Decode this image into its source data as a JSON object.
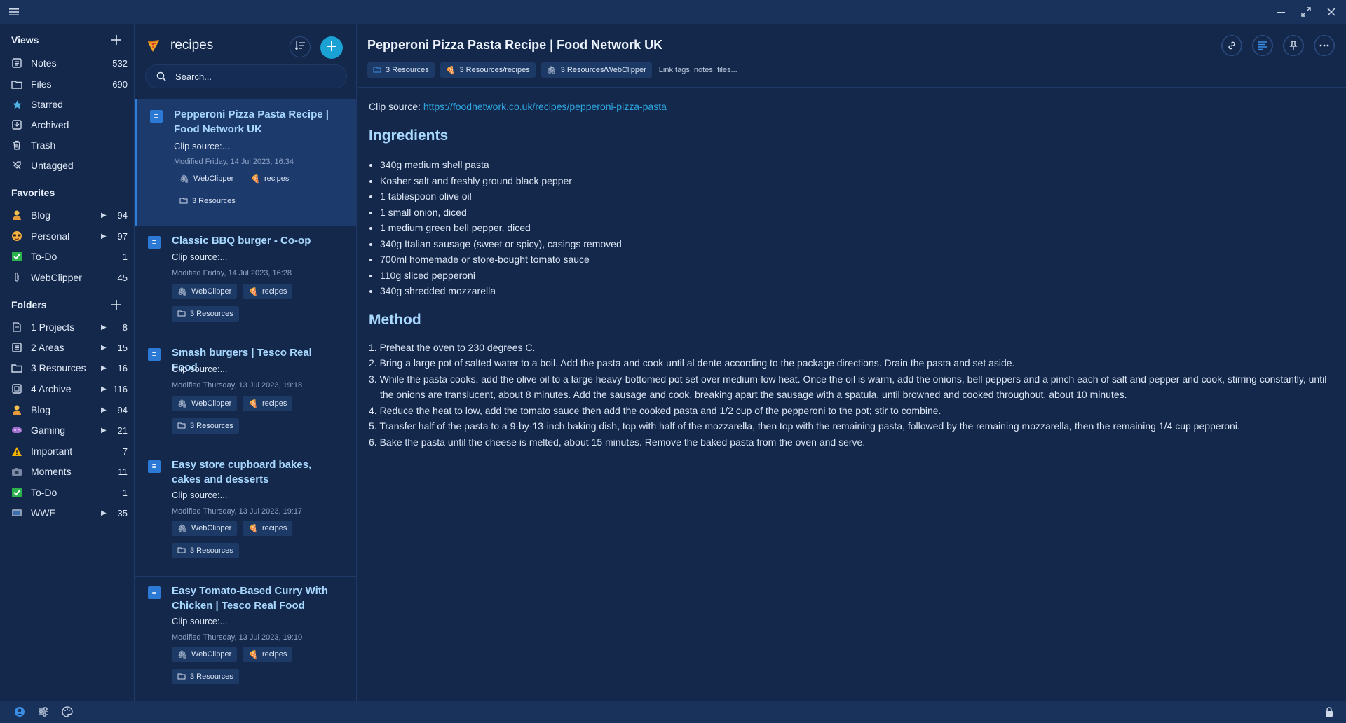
{
  "sidebar": {
    "views_title": "Views",
    "views": [
      {
        "label": "Notes",
        "count": "532",
        "icon": "notes-icon"
      },
      {
        "label": "Files",
        "count": "690",
        "icon": "folder-icon"
      },
      {
        "label": "Starred",
        "count": "",
        "icon": "star-icon"
      },
      {
        "label": "Archived",
        "count": "",
        "icon": "archive-icon"
      },
      {
        "label": "Trash",
        "count": "",
        "icon": "trash-icon"
      },
      {
        "label": "Untagged",
        "count": "",
        "icon": "untagged-icon"
      }
    ],
    "favorites_title": "Favorites",
    "favorites": [
      {
        "label": "Blog",
        "count": "94",
        "icon": "blog-emoji-icon"
      },
      {
        "label": "Personal",
        "count": "97",
        "icon": "sunglasses-emoji-icon"
      },
      {
        "label": "To-Do",
        "count": "1",
        "icon": "check-box-icon"
      },
      {
        "label": "WebClipper",
        "count": "45",
        "icon": "paperclip-icon"
      }
    ],
    "folders_title": "Folders",
    "folders": [
      {
        "label": "1 Projects",
        "count": "8",
        "icon": "document-icon"
      },
      {
        "label": "2 Areas",
        "count": "15",
        "icon": "list-icon"
      },
      {
        "label": "3 Resources",
        "count": "16",
        "icon": "folder-icon"
      },
      {
        "label": "4 Archive",
        "count": "116",
        "icon": "archive-box-icon"
      },
      {
        "label": "Blog",
        "count": "94",
        "icon": "blog-emoji-icon"
      },
      {
        "label": "Gaming",
        "count": "21",
        "icon": "gamepad-icon"
      },
      {
        "label": "Important",
        "count": "7",
        "icon": "warning-icon"
      },
      {
        "label": "Moments",
        "count": "11",
        "icon": "camera-icon"
      },
      {
        "label": "To-Do",
        "count": "1",
        "icon": "check-box-icon"
      },
      {
        "label": "WWE",
        "count": "35",
        "icon": "tv-icon"
      }
    ]
  },
  "notelist": {
    "title": "recipes",
    "search_placeholder": "Search...",
    "notes": [
      {
        "title": "Pepperoni Pizza Pasta Recipe | Food Network UK",
        "clip": "Clip source:...",
        "modified": "Modified Friday, 14 Jul 2023, 16:34",
        "tag1": "WebClipper",
        "tag2": "recipes",
        "folder": "3 Resources"
      },
      {
        "title": "Classic BBQ burger - Co-op",
        "clip": "Clip source:...",
        "modified": "Modified Friday, 14 Jul 2023, 16:28",
        "tag1": "WebClipper",
        "tag2": "recipes",
        "folder": "3 Resources"
      },
      {
        "title": "Smash burgers | Tesco Real Food",
        "clip": "Clip source:...",
        "modified": "Modified Thursday, 13 Jul 2023, 19:18",
        "tag1": "WebClipper",
        "tag2": "recipes",
        "folder": "3 Resources"
      },
      {
        "title": "Easy store cupboard bakes, cakes and desserts",
        "clip": "Clip source:...",
        "modified": "Modified Thursday, 13 Jul 2023, 19:17",
        "tag1": "WebClipper",
        "tag2": "recipes",
        "folder": "3 Resources"
      },
      {
        "title": "Easy Tomato-Based Curry With Chicken | Tesco Real Food",
        "clip": "Clip source:...",
        "modified": "Modified Thursday, 13 Jul 2023, 19:10",
        "tag1": "WebClipper",
        "tag2": "recipes",
        "folder": "3 Resources"
      }
    ]
  },
  "editor": {
    "title": "Pepperoni Pizza Pasta Recipe | Food Network UK",
    "tag_folder": "3 Resources",
    "tag_recipes": "3 Resources/recipes",
    "tag_webclipper": "3 Resources/WebClipper",
    "link_hint": "Link tags, notes, files...",
    "clip_label": "Clip source:",
    "clip_url": "https://foodnetwork.co.uk/recipes/pepperoni-pizza-pasta",
    "ingredients_heading": "Ingredients",
    "ingredients": [
      "340g medium shell pasta",
      "Kosher salt and freshly ground black pepper",
      "1 tablespoon olive oil",
      "1 small onion, diced",
      "1 medium green bell pepper, diced",
      "340g Italian sausage (sweet or spicy), casings removed",
      "700ml homemade or store-bought tomato sauce",
      "110g sliced pepperoni",
      "340g shredded mozzarella"
    ],
    "method_heading": "Method",
    "method": [
      "1. Preheat the oven to 230 degrees C.",
      "2. Bring a large pot of salted water to a boil. Add the pasta and cook until al dente according to the package directions. Drain the pasta and set aside.",
      "3. While the pasta cooks, add the olive oil to a large heavy-bottomed pot set over medium-low heat. Once the oil is warm, add the onions, bell peppers and a pinch each of salt and pepper and cook, stirring constantly, until the onions are translucent, about 8 minutes. Add the sausage and cook, breaking apart the sausage with a spatula, until browned and cooked throughout, about 10 minutes.",
      "4. Reduce the heat to low, add the tomato sauce then add the cooked pasta and 1/2 cup of the pepperoni to the pot; stir to combine.",
      "5. Transfer half of the pasta to a 9-by-13-inch baking dish, top with half of the mozzarella, then top with the remaining pasta, followed by the remaining mozzarella, then the remaining 1/4 cup pepperoni.",
      "6. Bake the pasta until the cheese is melted, about 15 minutes. Remove the baked pasta from the oven and serve."
    ]
  },
  "colors": {
    "background": "#13284b",
    "titlebar": "#19325c",
    "accent": "#19a2d3",
    "heading": "#a9d8ff",
    "link": "#2fa7e0"
  }
}
